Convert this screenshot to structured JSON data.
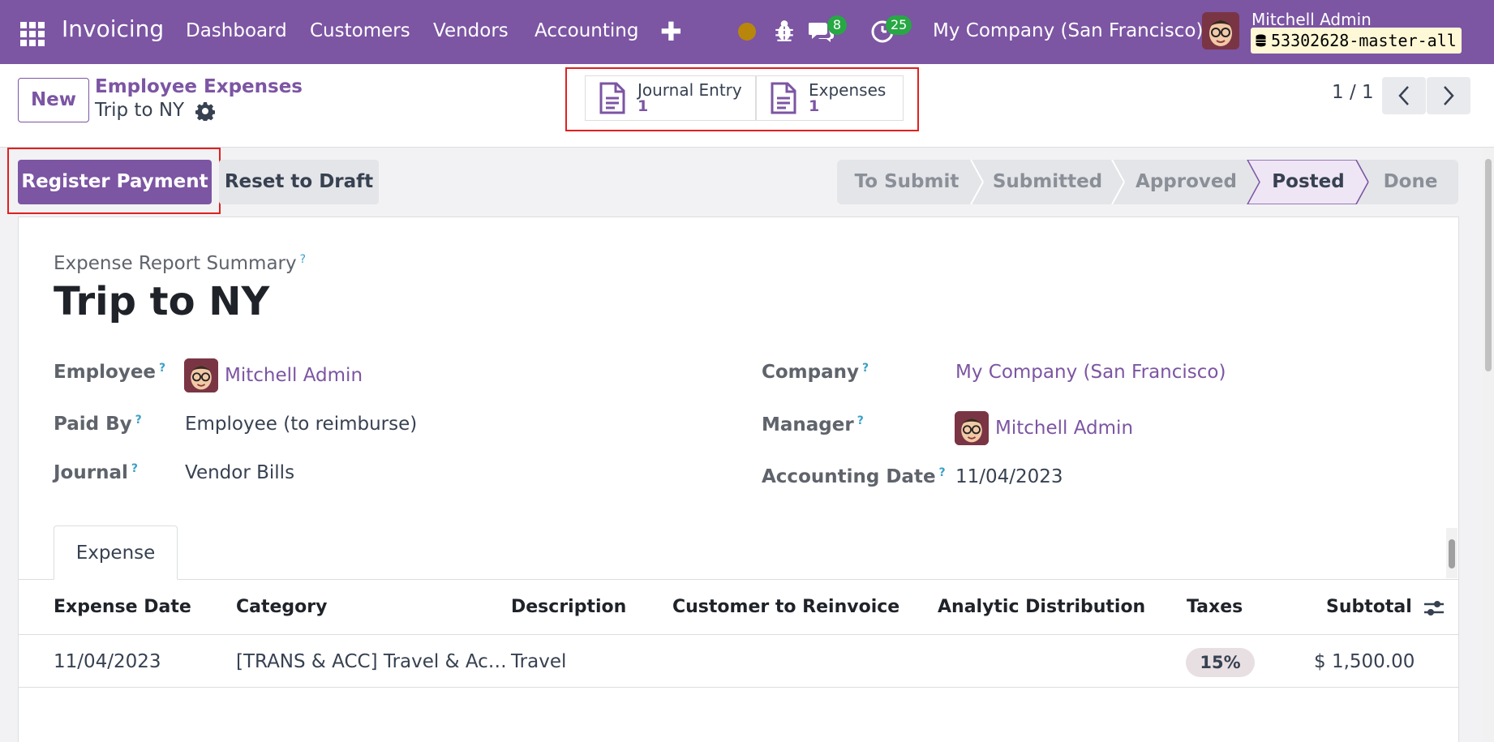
{
  "navbar": {
    "app_name": "Invoicing",
    "menu": [
      "Dashboard",
      "Customers",
      "Vendors",
      "Accounting"
    ],
    "messages_count": "8",
    "activities_count": "25",
    "company": "My Company (San Francisco)",
    "user_name": "Mitchell Admin",
    "database": "53302628-master-all"
  },
  "control_panel": {
    "new_label": "New",
    "breadcrumb_parent": "Employee Expenses",
    "breadcrumb_current": "Trip to NY",
    "smart_buttons": [
      {
        "label": "Journal Entry",
        "count": "1"
      },
      {
        "label": "Expenses",
        "count": "1"
      }
    ],
    "pager": "1 / 1"
  },
  "actions": {
    "register_payment": "Register Payment",
    "reset_to_draft": "Reset to Draft"
  },
  "statusbar": {
    "stages": [
      "To Submit",
      "Submitted",
      "Approved",
      "Posted",
      "Done"
    ],
    "current": "Posted"
  },
  "form": {
    "summary_label": "Expense Report Summary",
    "title": "Trip to NY",
    "question_mark": "?",
    "left_fields": {
      "employee_label": "Employee",
      "employee_value": "Mitchell Admin",
      "paid_by_label": "Paid By",
      "paid_by_value": "Employee (to reimburse)",
      "journal_label": "Journal",
      "journal_value": "Vendor Bills"
    },
    "right_fields": {
      "company_label": "Company",
      "company_value": "My Company (San Francisco)",
      "manager_label": "Manager",
      "manager_value": "Mitchell Admin",
      "accounting_date_label": "Accounting Date",
      "accounting_date_value": "11/04/2023"
    }
  },
  "notebook": {
    "tab_label": "Expense"
  },
  "expense_table": {
    "columns": [
      "Expense Date",
      "Category",
      "Description",
      "Customer to Reinvoice",
      "Analytic Distribution",
      "Taxes",
      "Subtotal"
    ],
    "rows": [
      {
        "expense_date": "11/04/2023",
        "category": "[TRANS & ACC] Travel & Ac…",
        "description": "Travel",
        "customer": "",
        "analytic": "",
        "taxes": "15%",
        "subtotal": "$ 1,500.00"
      }
    ]
  },
  "colors": {
    "brand": "#7c55a3",
    "highlight_box": "#e02020",
    "badge_green": "#28a745"
  }
}
